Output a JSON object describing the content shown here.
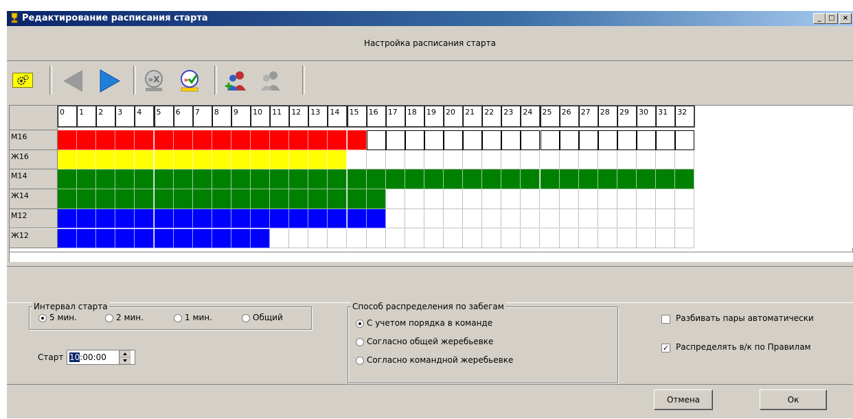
{
  "window": {
    "title": "Редактирование расписания старта",
    "controls": [
      "_",
      "□",
      "×"
    ]
  },
  "header": {
    "text": "Настройка расписания старта"
  },
  "toolbar": {
    "buttons": [
      {
        "name": "settings",
        "icon": "gears-icon"
      },
      {
        "name": "prev",
        "icon": "arrow-left-icon",
        "enabled": false
      },
      {
        "name": "next",
        "icon": "arrow-right-icon",
        "enabled": true
      },
      {
        "name": "unlink",
        "icon": "unlink-icon",
        "enabled": false
      },
      {
        "name": "link-check",
        "icon": "link-check-icon",
        "enabled": true
      },
      {
        "name": "add-group",
        "icon": "add-people-icon",
        "enabled": true
      },
      {
        "name": "remove-group",
        "icon": "people-icon",
        "enabled": false
      }
    ]
  },
  "schedule": {
    "columns": [
      "0",
      "1",
      "2",
      "3",
      "4",
      "5",
      "6",
      "7",
      "8",
      "9",
      "10",
      "11",
      "12",
      "13",
      "14",
      "15",
      "16",
      "17",
      "18",
      "19",
      "20",
      "21",
      "22",
      "23",
      "24",
      "25",
      "26",
      "27",
      "28",
      "29",
      "30",
      "31",
      "32"
    ],
    "rows": [
      {
        "label": "М16",
        "filled": 16,
        "color": "#ff0000",
        "framed": true
      },
      {
        "label": "Ж16",
        "filled": 15,
        "color": "#ffff00",
        "framed": false
      },
      {
        "label": "М14",
        "filled": 33,
        "color": "#008000",
        "framed": false
      },
      {
        "label": "Ж14",
        "filled": 17,
        "color": "#008000",
        "framed": false
      },
      {
        "label": "М12",
        "filled": 17,
        "color": "#0000ff",
        "framed": false
      },
      {
        "label": "Ж12",
        "filled": 11,
        "color": "#0000ff",
        "framed": false
      }
    ]
  },
  "interval": {
    "title": "Интервал старта",
    "options": [
      "5 мин.",
      "2 мин.",
      "1 мин.",
      "Общий"
    ],
    "selected": 0
  },
  "start": {
    "label": "Старт",
    "value_sel": "10",
    "value_rest": ":00:00"
  },
  "distribution": {
    "title": "Способ распределения по забегам",
    "options": [
      "С учетом порядка в команде",
      "Согласно общей жеребьевке",
      "Согласно командной жеребьевке"
    ],
    "selected": 0
  },
  "options": {
    "split_pairs": {
      "label": "Разбивать пары автоматически",
      "checked": false
    },
    "distribute_vk": {
      "label": "Распределять в/к  по Правилам",
      "checked": true
    }
  },
  "footer": {
    "cancel_label": "Отмена",
    "ok_label": "Ок"
  }
}
